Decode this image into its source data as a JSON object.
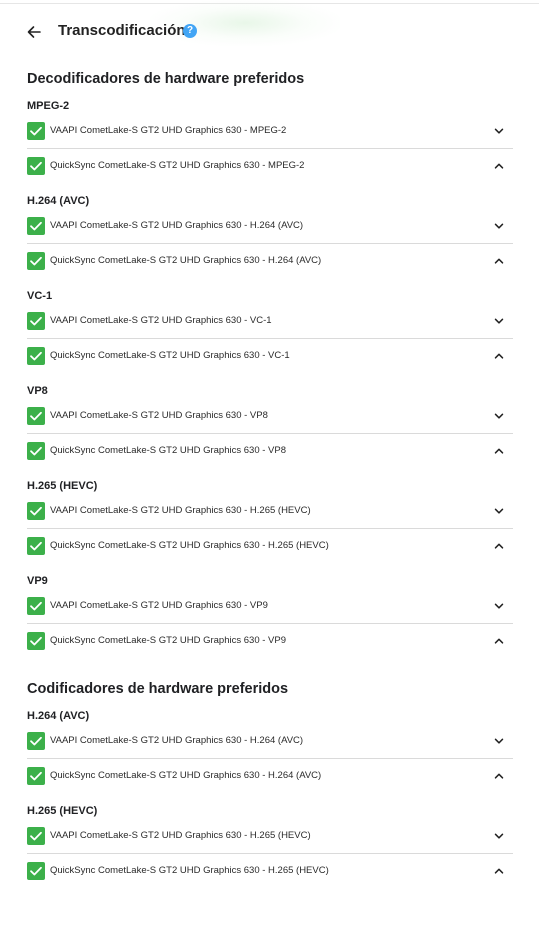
{
  "header": {
    "title": "Transcodificación",
    "help_glyph": "?",
    "icons": {
      "back": "arrow-left-icon",
      "help": "help-circle-icon"
    }
  },
  "colors": {
    "checkbox": "#3cb04a",
    "help": "#42a5f5",
    "divider": "#dadada"
  },
  "sections": [
    {
      "title": "Decodificadores de hardware preferidos",
      "groups": [
        {
          "codec": "MPEG-2",
          "items": [
            {
              "label": "VAAPI CometLake-S GT2 UHD Graphics 630 - MPEG-2",
              "checked": true,
              "chevron": "down"
            },
            {
              "label": "QuickSync CometLake-S GT2 UHD Graphics 630 - MPEG-2",
              "checked": true,
              "chevron": "up"
            }
          ]
        },
        {
          "codec": "H.264 (AVC)",
          "items": [
            {
              "label": "VAAPI CometLake-S GT2 UHD Graphics 630 - H.264 (AVC)",
              "checked": true,
              "chevron": "down"
            },
            {
              "label": "QuickSync CometLake-S GT2 UHD Graphics 630 - H.264 (AVC)",
              "checked": true,
              "chevron": "up"
            }
          ]
        },
        {
          "codec": "VC-1",
          "items": [
            {
              "label": "VAAPI CometLake-S GT2 UHD Graphics 630 - VC-1",
              "checked": true,
              "chevron": "down"
            },
            {
              "label": "QuickSync CometLake-S GT2 UHD Graphics 630 - VC-1",
              "checked": true,
              "chevron": "up"
            }
          ]
        },
        {
          "codec": "VP8",
          "items": [
            {
              "label": "VAAPI CometLake-S GT2 UHD Graphics 630 - VP8",
              "checked": true,
              "chevron": "down"
            },
            {
              "label": "QuickSync CometLake-S GT2 UHD Graphics 630 - VP8",
              "checked": true,
              "chevron": "up"
            }
          ]
        },
        {
          "codec": "H.265 (HEVC)",
          "items": [
            {
              "label": "VAAPI CometLake-S GT2 UHD Graphics 630 - H.265 (HEVC)",
              "checked": true,
              "chevron": "down"
            },
            {
              "label": "QuickSync CometLake-S GT2 UHD Graphics 630 - H.265 (HEVC)",
              "checked": true,
              "chevron": "up"
            }
          ]
        },
        {
          "codec": "VP9",
          "items": [
            {
              "label": "VAAPI CometLake-S GT2 UHD Graphics 630 - VP9",
              "checked": true,
              "chevron": "down"
            },
            {
              "label": "QuickSync CometLake-S GT2 UHD Graphics 630 - VP9",
              "checked": true,
              "chevron": "up"
            }
          ]
        }
      ]
    },
    {
      "title": "Codificadores de hardware preferidos",
      "groups": [
        {
          "codec": "H.264 (AVC)",
          "items": [
            {
              "label": "VAAPI CometLake-S GT2 UHD Graphics 630 - H.264 (AVC)",
              "checked": true,
              "chevron": "down"
            },
            {
              "label": "QuickSync CometLake-S GT2 UHD Graphics 630 - H.264 (AVC)",
              "checked": true,
              "chevron": "up"
            }
          ]
        },
        {
          "codec": "H.265 (HEVC)",
          "items": [
            {
              "label": "VAAPI CometLake-S GT2 UHD Graphics 630 - H.265 (HEVC)",
              "checked": true,
              "chevron": "down"
            },
            {
              "label": "QuickSync CometLake-S GT2 UHD Graphics 630 - H.265 (HEVC)",
              "checked": true,
              "chevron": "up"
            }
          ]
        }
      ]
    }
  ]
}
